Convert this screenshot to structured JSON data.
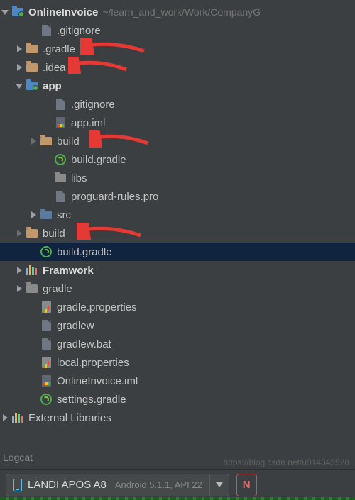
{
  "root": {
    "name": "OnlineInvoice",
    "path": "~/learn_and_work/Work/CompanyG"
  },
  "items": {
    "gitignore_root": ".gitignore",
    "gradle_hidden": ".gradle",
    "idea": ".idea",
    "app": "app",
    "gitignore_app": ".gitignore",
    "app_iml": "app.iml",
    "build_app": "build",
    "build_gradle_app": "build.gradle",
    "libs": "libs",
    "proguard": "proguard-rules.pro",
    "src": "src",
    "build_root": "build",
    "build_gradle_root": "build.gradle",
    "framwork": "Framwork",
    "gradle_dir": "gradle",
    "gradle_props": "gradle.properties",
    "gradlew": "gradlew",
    "gradlew_bat": "gradlew.bat",
    "local_props": "local.properties",
    "project_iml": "OnlineInvoice.iml",
    "settings_gradle": "settings.gradle",
    "ext_lib": "External Libraries"
  },
  "logcat_label": "Logcat",
  "device": {
    "name": "LANDI APOS A8",
    "sub": "Android 5.1.1, API 22"
  },
  "new_button": "N",
  "watermark": "https://blog.csdn.net/u014343528"
}
